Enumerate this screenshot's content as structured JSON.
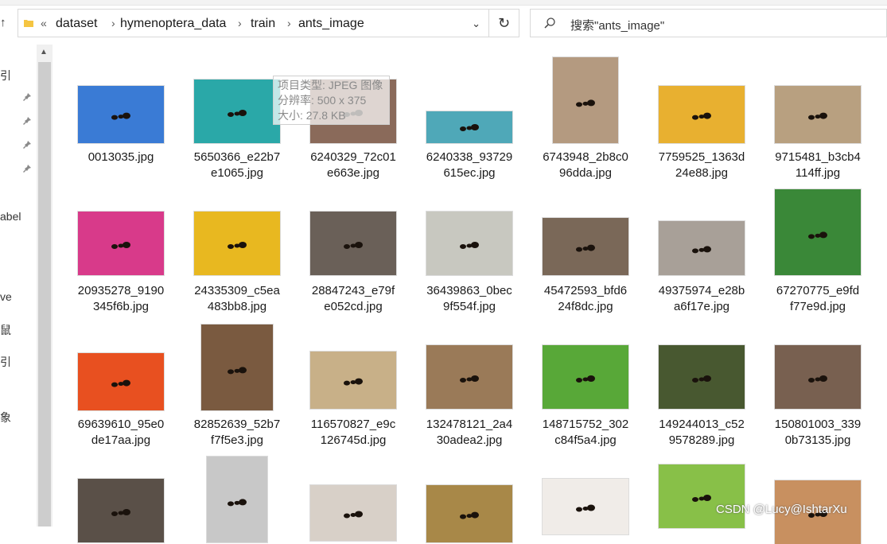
{
  "address": {
    "overflow_glyph": "«",
    "crumbs": [
      "dataset",
      "hymenoptera_data",
      "train",
      "ants_image"
    ],
    "separator": "›",
    "dropdown": "⌄"
  },
  "refresh_glyph": "↻",
  "search": {
    "placeholder": "搜索\"ants_image\""
  },
  "nav": {
    "up_arrow": "↑",
    "fragments": [
      "引",
      "abel",
      "ve",
      "鼠",
      "引",
      "象"
    ]
  },
  "tooltip": {
    "type": "项目类型: JPEG 图像",
    "resolution": "分辨率: 500 x 375",
    "size": "大小: 27.8 KB"
  },
  "files": [
    {
      "line1": "0013035.jpg",
      "line2": "",
      "color": "#3a7bd5"
    },
    {
      "line1": "5650366_e22b7",
      "line2": "e1065.jpg",
      "color": "#2aa8a8"
    },
    {
      "line1": "6240329_72c01",
      "line2": "e663e.jpg",
      "color": "#8a6a5a"
    },
    {
      "line1": "6240338_93729",
      "line2": "615ec.jpg",
      "color": "#4fa8b8"
    },
    {
      "line1": "6743948_2b8c0",
      "line2": "96dda.jpg",
      "color": "#b49a80"
    },
    {
      "line1": "7759525_1363d",
      "line2": "24e88.jpg",
      "color": "#e8b030"
    },
    {
      "line1": "9715481_b3cb4",
      "line2": "114ff.jpg",
      "color": "#b8a080"
    },
    {
      "line1": "20935278_9190",
      "line2": "345f6b.jpg",
      "color": "#d83a8a"
    },
    {
      "line1": "24335309_c5ea",
      "line2": "483bb8.jpg",
      "color": "#e8b820"
    },
    {
      "line1": "28847243_e79f",
      "line2": "e052cd.jpg",
      "color": "#6a6058"
    },
    {
      "line1": "36439863_0bec",
      "line2": "9f554f.jpg",
      "color": "#c8c8c0"
    },
    {
      "line1": "45472593_bfd6",
      "line2": "24f8dc.jpg",
      "color": "#7a6858"
    },
    {
      "line1": "49375974_e28b",
      "line2": "a6f17e.jpg",
      "color": "#a8a098"
    },
    {
      "line1": "67270775_e9fd",
      "line2": "f77e9d.jpg",
      "color": "#3a8838"
    },
    {
      "line1": "69639610_95e0",
      "line2": "de17aa.jpg",
      "color": "#e85020"
    },
    {
      "line1": "82852639_52b7",
      "line2": "f7f5e3.jpg",
      "color": "#7a5a40"
    },
    {
      "line1": "116570827_e9c",
      "line2": "126745d.jpg",
      "color": "#c8b088"
    },
    {
      "line1": "132478121_2a4",
      "line2": "30adea2.jpg",
      "color": "#9a7a58"
    },
    {
      "line1": "148715752_302",
      "line2": "c84f5a4.jpg",
      "color": "#58a838"
    },
    {
      "line1": "149244013_c52",
      "line2": "9578289.jpg",
      "color": "#485830"
    },
    {
      "line1": "150801003_339",
      "line2": "0b73135.jpg",
      "color": "#786050"
    },
    {
      "line1": "",
      "line2": "",
      "color": "#5a5048"
    },
    {
      "line1": "",
      "line2": "",
      "color": "#c8c8c8"
    },
    {
      "line1": "",
      "line2": "",
      "color": "#d8d0c8"
    },
    {
      "line1": "",
      "line2": "",
      "color": "#a88848"
    },
    {
      "line1": "",
      "line2": "",
      "color": "#f0ece8"
    },
    {
      "line1": "",
      "line2": "",
      "color": "#88c048"
    },
    {
      "line1": "",
      "line2": "",
      "color": "#c89060"
    }
  ],
  "watermark": "CSDN @Lucy@IshtarXu",
  "colors": {
    "border": "#d9d9d9",
    "text": "#1a1a1a",
    "scroll_thumb": "#cdcdcd"
  }
}
